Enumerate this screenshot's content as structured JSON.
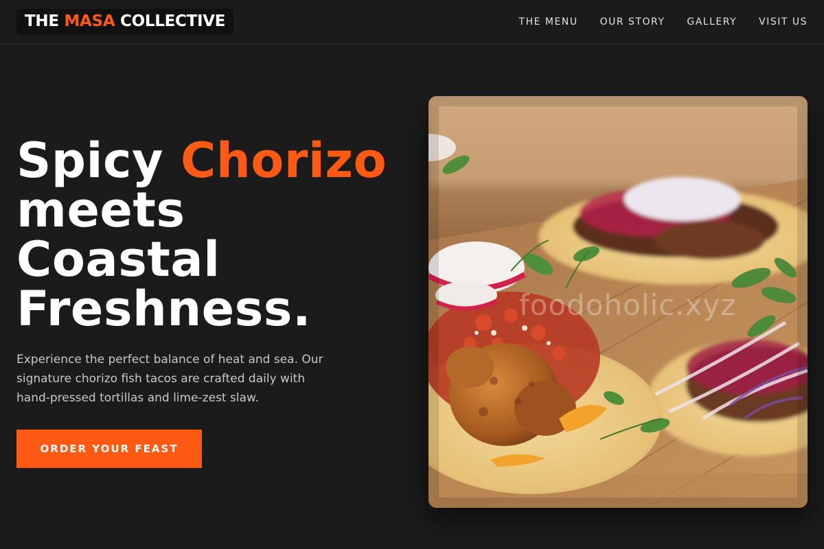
{
  "brand": {
    "logo_part1": "THE ",
    "logo_accent": "MASA",
    "logo_part2": " COLLECTIVE"
  },
  "nav": {
    "items": [
      {
        "label": "THE MENU"
      },
      {
        "label": "OUR STORY"
      },
      {
        "label": "GALLERY"
      },
      {
        "label": "VISIT US"
      }
    ]
  },
  "hero": {
    "headline_line1": "Spicy ",
    "headline_accent": "Chorizo",
    "headline_line2": "meets",
    "headline_line3": "Coastal",
    "headline_line4": "Freshness.",
    "description": "Experience the perfect balance of heat and sea. Our signature chorizo fish tacos are crafted daily with hand-pressed tortillas and lime-zest slaw.",
    "cta_label": "ORDER YOUR FEAST"
  },
  "photo": {
    "alt": "Chorizo fish tacos on a wooden board",
    "watermark": "foodoholic.xyz"
  },
  "colors": {
    "background": "#1b1b1b",
    "accent": "#ff5a14",
    "text": "#ffffff",
    "muted_text": "#c8c8c8"
  }
}
